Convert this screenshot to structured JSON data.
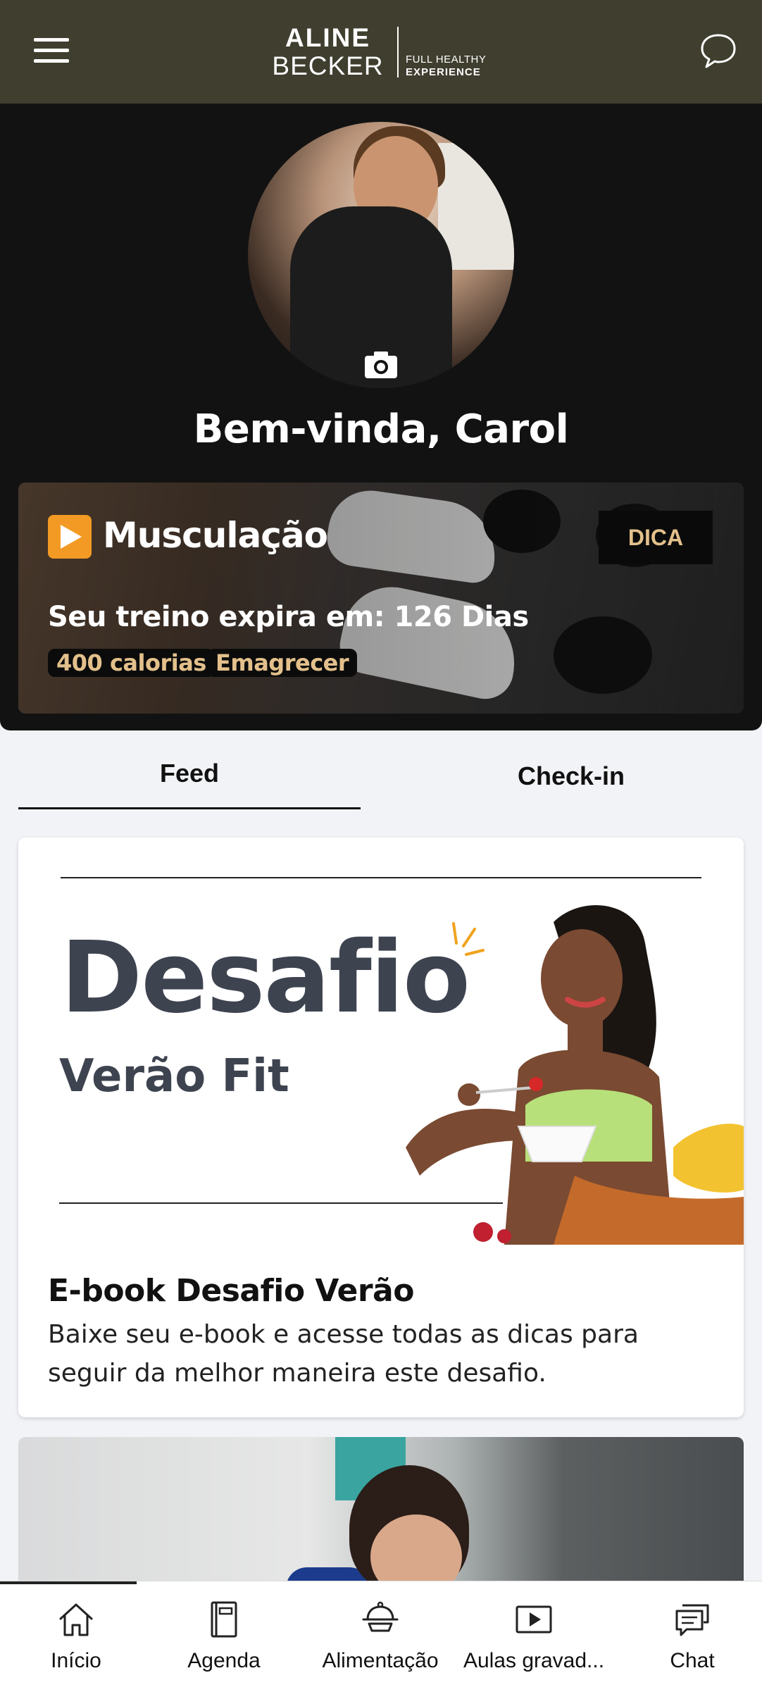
{
  "header": {
    "logo_line1": "ALINE",
    "logo_line2": "BECKER",
    "logo_tag1": "FULL HEALTHY",
    "logo_tag2": "EXPERIENCE",
    "menu_icon": "hamburger-icon",
    "chat_icon": "chat-bubble-icon",
    "background": "#3f3e2f"
  },
  "profile": {
    "welcome": "Bem-vinda, Carol",
    "camera_icon": "camera-icon"
  },
  "workout": {
    "icon": "play-icon",
    "title": "Musculação",
    "tip_label": "DICA",
    "expire_text": "Seu treino expira em: 126 Dias",
    "tags": [
      "400 calorias",
      "Emagrecer"
    ],
    "accent": "#e3c08b"
  },
  "tabs": {
    "feed": "Feed",
    "checkin": "Check-in",
    "active": "feed"
  },
  "feed": {
    "items": [
      {
        "banner_title": "Desafio",
        "banner_subtitle": "Verão Fit",
        "title": "E-book Desafio Verão",
        "description": "Baixe seu e-book e acesse todas as dicas para seguir da melhor maneira este desafio."
      }
    ]
  },
  "bottom_nav": {
    "items": [
      {
        "label": "Início",
        "icon": "home-icon"
      },
      {
        "label": "Agenda",
        "icon": "agenda-icon"
      },
      {
        "label": "Alimentação",
        "icon": "food-icon"
      },
      {
        "label": "Aulas gravad...",
        "icon": "video-icon"
      },
      {
        "label": "Chat",
        "icon": "chat-icon"
      }
    ],
    "active": "Início"
  }
}
